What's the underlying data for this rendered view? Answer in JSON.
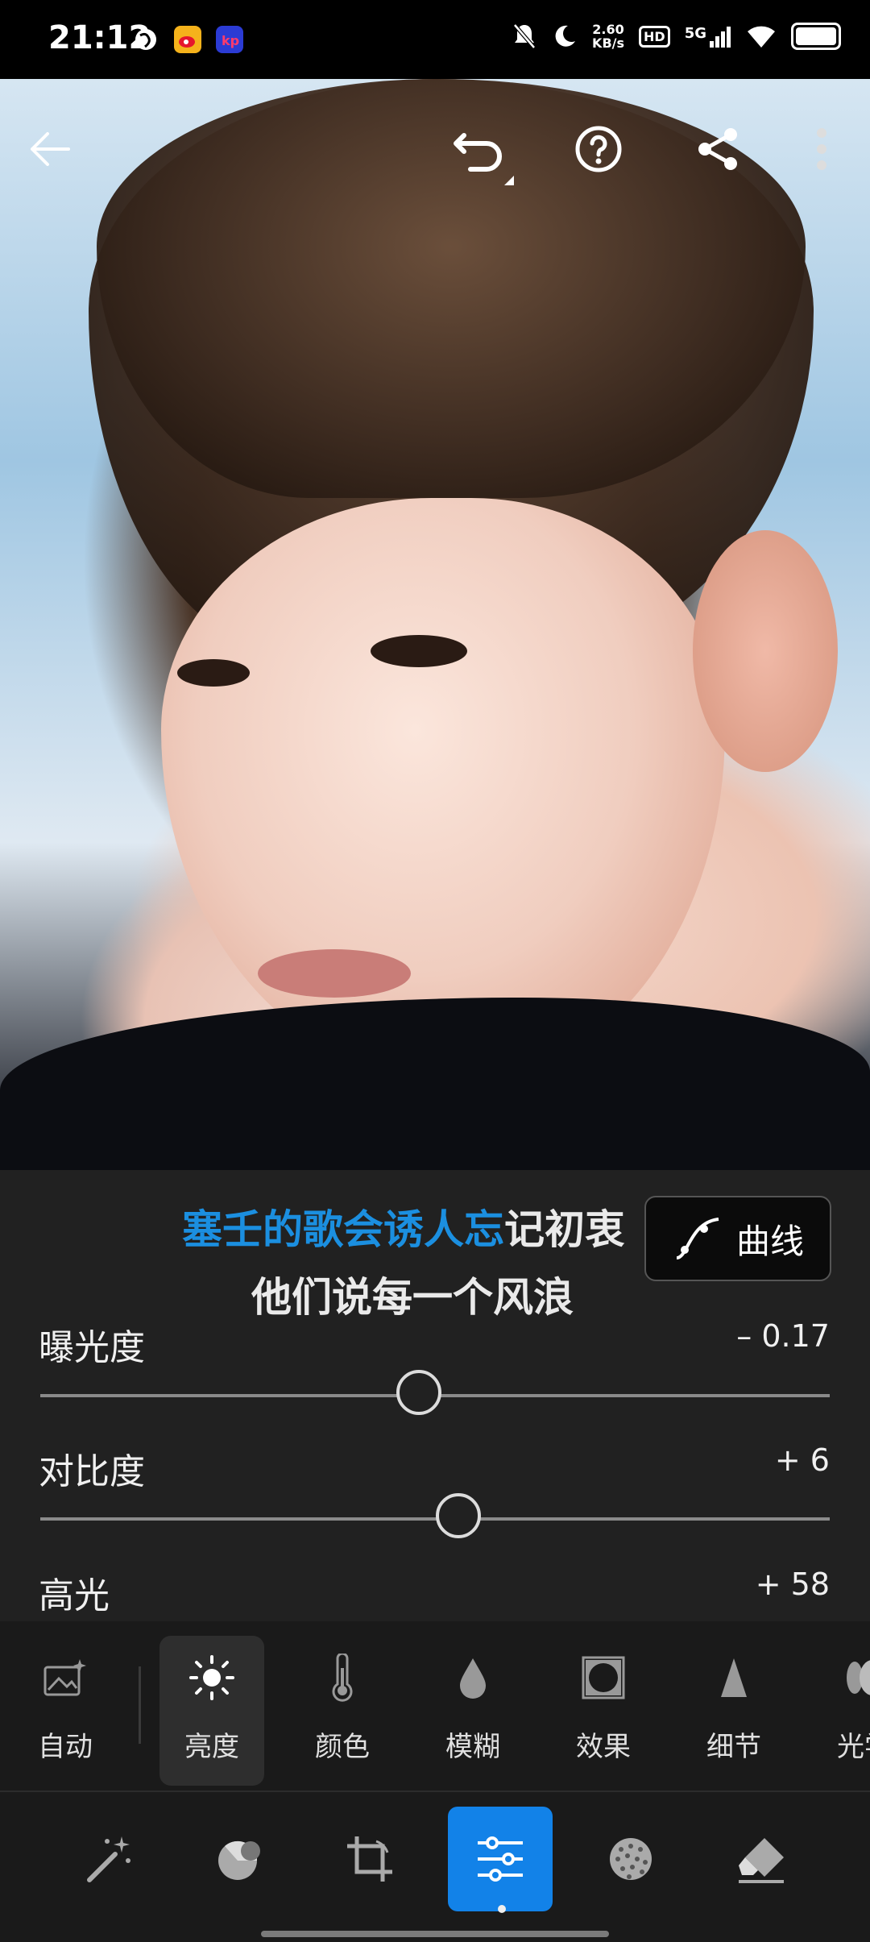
{
  "status_bar": {
    "time": "21:12",
    "net_speed_value": "2.60",
    "net_speed_unit": "KB/s",
    "hd_label": "HD",
    "network_label": "5G"
  },
  "photo_toolbar": {
    "icons": [
      "back-arrow-icon",
      "undo-icon",
      "help-icon",
      "share-icon",
      "more-vertical-icon"
    ]
  },
  "lyrics": {
    "line1_highlight": "塞壬的歌会诱人忘",
    "line1_rest": "记初衷",
    "line2": "他们说每一个风浪"
  },
  "curve_button": {
    "label": "曲线"
  },
  "adjustments": [
    {
      "label": "曝光度",
      "value": "– 0.17",
      "level": 0.48
    },
    {
      "label": "对比度",
      "value": "+ 6",
      "level": 0.53
    },
    {
      "label": "高光",
      "value": "+ 58"
    }
  ],
  "tools": [
    {
      "label": "自动",
      "icon": "auto-image-icon"
    },
    {
      "label": "亮度",
      "icon": "sun-icon",
      "active": true
    },
    {
      "label": "颜色",
      "icon": "thermometer-icon"
    },
    {
      "label": "模糊",
      "icon": "drop-icon"
    },
    {
      "label": "效果",
      "icon": "vignette-icon"
    },
    {
      "label": "细节",
      "icon": "triangle-icon"
    },
    {
      "label": "光学",
      "icon": "lens-icon"
    }
  ],
  "bottom_nav": {
    "items": [
      "magic-wand-icon",
      "selective-icon",
      "crop-icon",
      "sliders-icon",
      "grain-icon",
      "eraser-icon"
    ],
    "active": "sliders-icon"
  }
}
